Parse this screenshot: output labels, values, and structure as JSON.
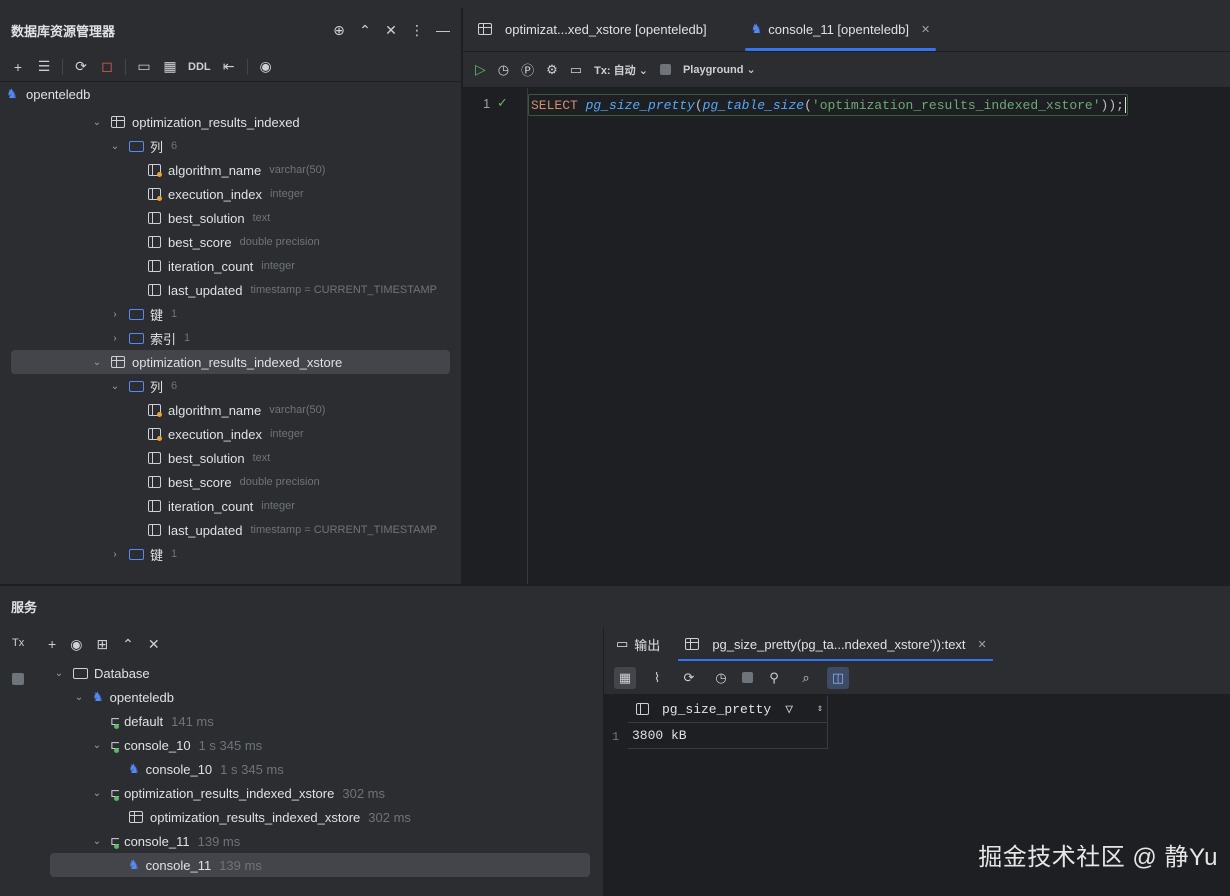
{
  "explorer": {
    "title": "数据库资源管理器",
    "root": "openteledb",
    "tables": [
      {
        "name": "optimization_results_indexed",
        "columns_label": "列",
        "columns_count": "6",
        "columns": [
          {
            "name": "algorithm_name",
            "type": "varchar(50)",
            "key": true
          },
          {
            "name": "execution_index",
            "type": "integer",
            "key": true
          },
          {
            "name": "best_solution",
            "type": "text",
            "key": false
          },
          {
            "name": "best_score",
            "type": "double precision",
            "key": false
          },
          {
            "name": "iteration_count",
            "type": "integer",
            "key": false
          },
          {
            "name": "last_updated",
            "type": "timestamp = CURRENT_TIMESTAMP",
            "key": false
          }
        ],
        "keys_label": "键",
        "keys_count": "1",
        "indexes_label": "索引",
        "indexes_count": "1"
      },
      {
        "name": "optimization_results_indexed_xstore",
        "columns_label": "列",
        "columns_count": "6",
        "columns": [
          {
            "name": "algorithm_name",
            "type": "varchar(50)",
            "key": true
          },
          {
            "name": "execution_index",
            "type": "integer",
            "key": true
          },
          {
            "name": "best_solution",
            "type": "text",
            "key": false
          },
          {
            "name": "best_score",
            "type": "double precision",
            "key": false
          },
          {
            "name": "iteration_count",
            "type": "integer",
            "key": false
          },
          {
            "name": "last_updated",
            "type": "timestamp = CURRENT_TIMESTAMP",
            "key": false
          }
        ],
        "keys_label": "键",
        "keys_count": "1"
      }
    ],
    "toolbar_ddl": "DDL"
  },
  "editor": {
    "tabs": [
      {
        "label": "optimizat...xed_xstore [openteledb]",
        "active": false
      },
      {
        "label": "console_11 [openteledb]",
        "active": true
      }
    ],
    "tx_label": "Tx: 自动",
    "playground_label": "Playground",
    "line_number": "1",
    "code": {
      "kw": "SELECT",
      "fn1": "pg_size_pretty",
      "fn2": "pg_table_size",
      "str": "'optimization_results_indexed_xstore'",
      "tail": "));"
    }
  },
  "services": {
    "title": "服务",
    "tx_badge": "Tx",
    "tree": {
      "database": "Database",
      "connection": "openteledb",
      "items": [
        {
          "label": "default",
          "time": "141 ms",
          "indent": 2,
          "icon": "session"
        },
        {
          "label": "console_10",
          "time": "1 s 345 ms",
          "indent": 2,
          "icon": "session",
          "expanded": true
        },
        {
          "label": "console_10",
          "time": "1 s 345 ms",
          "indent": 3,
          "icon": "console"
        },
        {
          "label": "optimization_results_indexed_xstore",
          "time": "302 ms",
          "indent": 2,
          "icon": "session",
          "expanded": true
        },
        {
          "label": "optimization_results_indexed_xstore",
          "time": "302 ms",
          "indent": 3,
          "icon": "table"
        },
        {
          "label": "console_11",
          "time": "139 ms",
          "indent": 2,
          "icon": "session",
          "expanded": true
        },
        {
          "label": "console_11",
          "time": "139 ms",
          "indent": 3,
          "icon": "console",
          "selected": true
        }
      ]
    },
    "result": {
      "output_tab": "输出",
      "result_tab": "pg_size_pretty(pg_ta...ndexed_xstore')):text",
      "column": "pg_size_pretty",
      "row_number": "1",
      "value": "3800 kB"
    }
  },
  "watermark": "掘金技术社区 @ 静Yu"
}
